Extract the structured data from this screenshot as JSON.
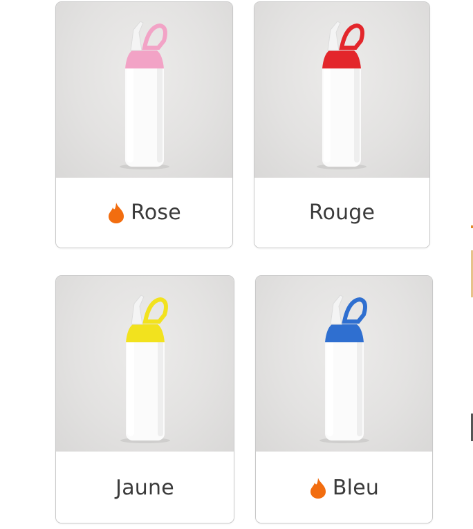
{
  "colors": {
    "pink_cap": "#f2a3c6",
    "red_cap": "#e3262b",
    "yellow_cap": "#f2e21e",
    "blue_cap": "#2f6fd0",
    "flame": "#f26d0f"
  },
  "cards": [
    {
      "label": "Rose",
      "hot": true,
      "cap_color": "#f2a3c6",
      "icon": "flame-icon"
    },
    {
      "label": "Rouge",
      "hot": false,
      "cap_color": "#e3262b"
    },
    {
      "label": "Jaune",
      "hot": false,
      "cap_color": "#f2e21e"
    },
    {
      "label": "Bleu",
      "hot": true,
      "cap_color": "#2f6fd0",
      "icon": "flame-icon"
    }
  ]
}
